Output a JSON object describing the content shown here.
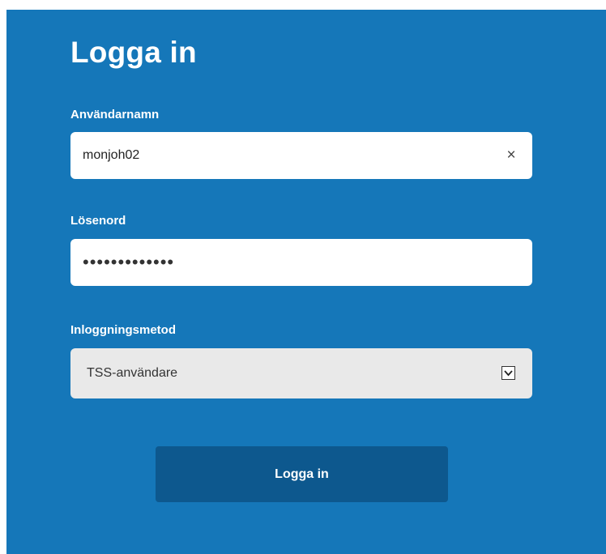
{
  "login": {
    "title": "Logga in",
    "username": {
      "label": "Användarnamn",
      "value": "monjoh02",
      "clear_icon": "×"
    },
    "password": {
      "label": "Lösenord",
      "value": "•••••••••••••"
    },
    "method": {
      "label": "Inloggningsmetod",
      "selected": "TSS-användare"
    },
    "submit_label": "Logga in"
  },
  "colors": {
    "panel_background": "#1577b9",
    "button_background": "#0d588e",
    "select_background": "#e9e9e9"
  },
  "icons": {
    "clear": "close-icon",
    "dropdown": "chevron-down-icon"
  }
}
